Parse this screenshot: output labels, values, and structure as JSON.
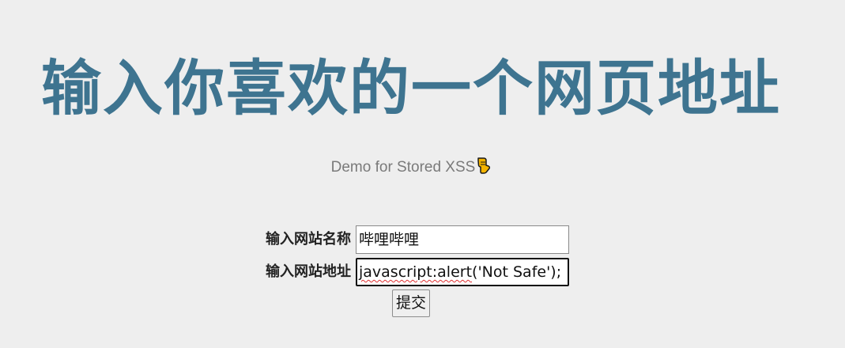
{
  "page": {
    "title": "输入你喜欢的一个网页地址",
    "subtitle": "Demo for Stored XSS",
    "subtitle_icon": "pointing-down-hand-icon"
  },
  "form": {
    "name_label": "输入网站名称",
    "name_value": "哔哩哔哩",
    "url_label": "输入网站地址",
    "url_value_misspelled": "javascript:alert",
    "url_value_rest": "('Not Safe');",
    "submit_label": "提交"
  },
  "colors": {
    "background": "#eeeeee",
    "title": "#3e7490",
    "subtitle": "#7a7a7a",
    "spellcheck": "#e03030"
  }
}
